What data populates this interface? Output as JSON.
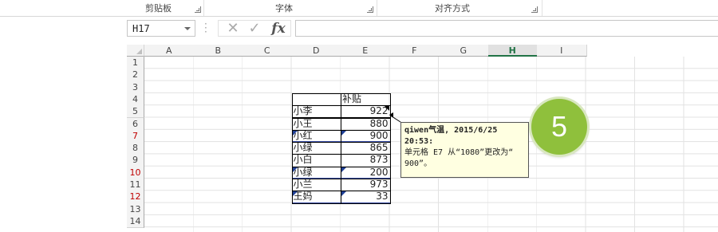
{
  "ribbon": {
    "groups": [
      {
        "label": "剪贴板"
      },
      {
        "label": "字体"
      },
      {
        "label": "对齐方式"
      }
    ]
  },
  "formula_bar": {
    "name_box": "H17",
    "cancel_symbol": "✕",
    "enter_symbol": "✓",
    "fx_label": "fx",
    "formula": ""
  },
  "sheet": {
    "columns": [
      "A",
      "B",
      "C",
      "D",
      "E",
      "F",
      "G",
      "H",
      "I"
    ],
    "selected_column": "H",
    "rows": [
      "1",
      "2",
      "3",
      "4",
      "5",
      "6",
      "7",
      "8",
      "9",
      "10",
      "11",
      "12",
      "13",
      "14"
    ],
    "highlighted_rows": [
      "7",
      "10",
      "12"
    ],
    "table": {
      "header": "补贴",
      "records": [
        {
          "name": "小李",
          "value": "922"
        },
        {
          "name": "小王",
          "value": "880"
        },
        {
          "name": "小红",
          "value": "900"
        },
        {
          "name": "小绿",
          "value": "865"
        },
        {
          "name": "小白",
          "value": "873"
        },
        {
          "name": "小绿",
          "value": "200"
        },
        {
          "name": "小兰",
          "value": "973"
        },
        {
          "name": "王妈",
          "value": "33"
        }
      ]
    }
  },
  "comment": {
    "author": "qiwen气温",
    "date": "2015/6/25",
    "time": "20:53:",
    "text_line1": "单元格 E7 从“1080”更改为“",
    "text_line2": "900”。"
  },
  "badge": {
    "number": "5"
  },
  "colors": {
    "accent": "#217346",
    "badge": "#8fc03c",
    "row_header_red": "#c00000",
    "comment_bg": "#ffffe1"
  }
}
